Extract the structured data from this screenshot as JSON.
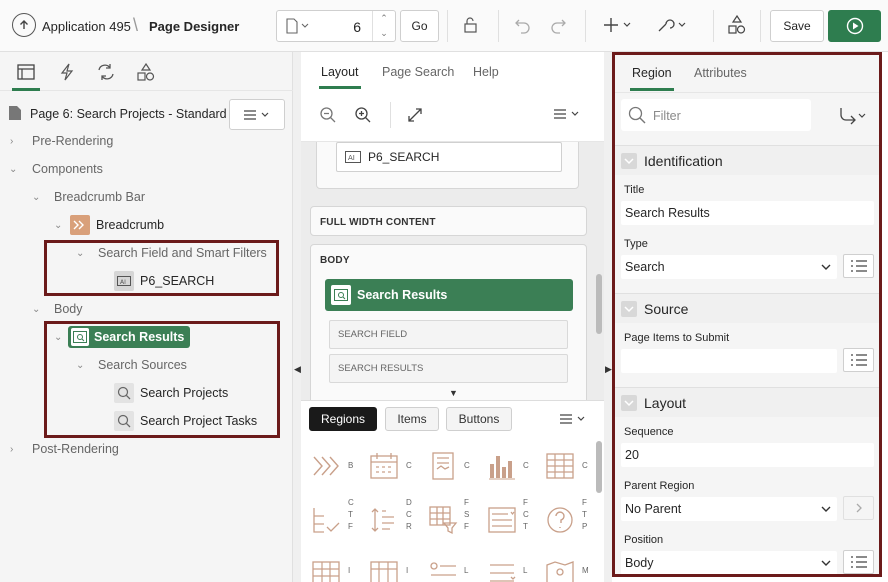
{
  "toolbar": {
    "app_name": "Application 495",
    "separator": "\\",
    "page_title": "Page Designer",
    "page_number": "6",
    "go_label": "Go",
    "save_label": "Save"
  },
  "left": {
    "tree_title": "Page 6: Search Projects - Standard",
    "nodes": {
      "pre": "Pre-Rendering",
      "components": "Components",
      "breadcrumb_bar": "Breadcrumb Bar",
      "breadcrumb": "Breadcrumb",
      "search_field": "Search Field and Smart Filters",
      "p6_search": "P6_SEARCH",
      "body": "Body",
      "search_results": "Search Results",
      "search_sources": "Search Sources",
      "search_projects": "Search Projects",
      "search_project_tasks": "Search Project Tasks",
      "post": "Post-Rendering"
    }
  },
  "middle": {
    "tabs": [
      "Layout",
      "Page Search",
      "Help"
    ],
    "canvas": {
      "p6_search": "P6_SEARCH",
      "full_width": "FULL WIDTH CONTENT",
      "body": "BODY",
      "search_results": "Search Results",
      "slot_search_field": "SEARCH FIELD",
      "slot_search_results": "SEARCH RESULTS"
    },
    "gallery_tabs": [
      "Regions",
      "Items",
      "Buttons"
    ]
  },
  "right": {
    "tabs": [
      "Region",
      "Attributes"
    ],
    "filter_placeholder": "Filter",
    "identification": {
      "heading": "Identification",
      "title_label": "Title",
      "title_value": "Search Results",
      "type_label": "Type",
      "type_value": "Search"
    },
    "source": {
      "heading": "Source",
      "items_label": "Page Items to Submit",
      "items_value": ""
    },
    "layout": {
      "heading": "Layout",
      "sequence_label": "Sequence",
      "sequence_value": "20",
      "parent_label": "Parent Region",
      "parent_value": "No Parent",
      "position_label": "Position",
      "position_value": "Body"
    }
  },
  "colors": {
    "accent": "#2e7d4f",
    "highlight_border": "#6b1a1a",
    "region_green": "#3b7f55",
    "breadcrumb_orange": "#d9a07a"
  }
}
